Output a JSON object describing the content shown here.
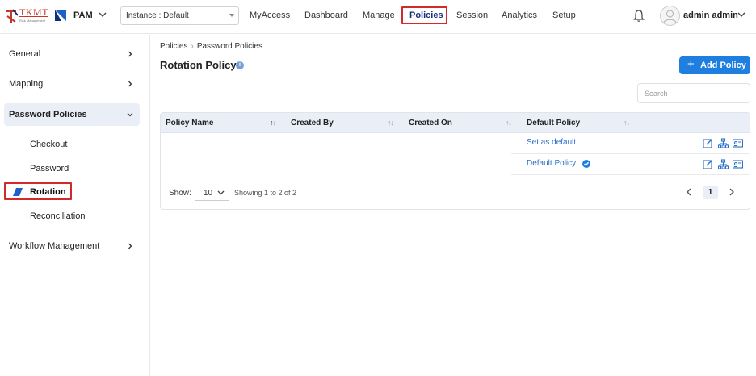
{
  "brand": {
    "logo_text": "TKMT",
    "logo_sub": "Risk Management",
    "product": "PAM"
  },
  "instance": {
    "label": "Instance : Default"
  },
  "nav": {
    "items": [
      {
        "label": "MyAccess",
        "active": false
      },
      {
        "label": "Dashboard",
        "active": false
      },
      {
        "label": "Manage",
        "active": false
      },
      {
        "label": "Policies",
        "active": true
      },
      {
        "label": "Session",
        "active": false
      },
      {
        "label": "Analytics",
        "active": false
      },
      {
        "label": "Setup",
        "active": false
      }
    ]
  },
  "user": {
    "name": "admin admin"
  },
  "sidebar": {
    "items": [
      {
        "label": "General"
      },
      {
        "label": "Mapping"
      },
      {
        "label": "Password Policies"
      },
      {
        "label": "Workflow Management"
      }
    ],
    "subitems": [
      {
        "label": "Checkout"
      },
      {
        "label": "Password"
      },
      {
        "label": "Rotation"
      },
      {
        "label": "Reconciliation"
      }
    ]
  },
  "breadcrumb": {
    "root": "Policies",
    "current": "Password Policies"
  },
  "page": {
    "title": "Rotation Policy",
    "add_label": "Add Policy",
    "search_placeholder": "Search"
  },
  "table": {
    "columns": [
      "Policy Name",
      "Created By",
      "Created On",
      "Default Policy"
    ],
    "rows": [
      {
        "default_policy": "Set as default",
        "is_default": false
      },
      {
        "default_policy": "Default Policy",
        "is_default": true
      }
    ]
  },
  "pagination": {
    "show_label": "Show:",
    "page_size": "10",
    "showing": "Showing 1 to 2 of 2",
    "current_page": "1"
  },
  "colors": {
    "accent": "#1e7fe0",
    "highlight": "#d22a2a",
    "nav_active": "#1a2f7a"
  }
}
